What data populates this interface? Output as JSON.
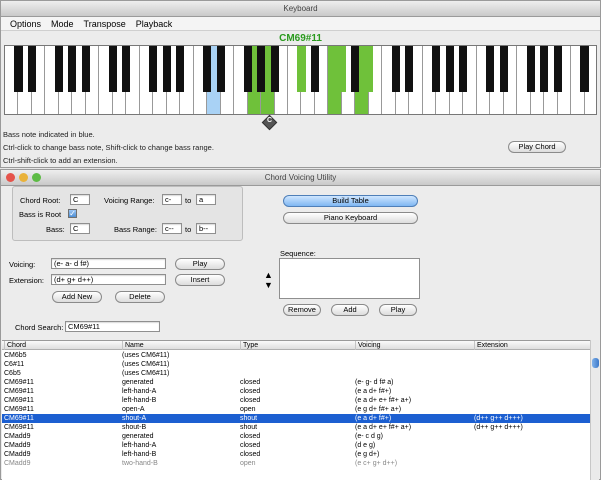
{
  "keyboard_window": {
    "title": "Keyboard",
    "menu": [
      "Options",
      "Mode",
      "Transpose",
      "Playback"
    ],
    "chord_name": "CM69#11",
    "bass_marker": "C",
    "hints": [
      "Bass note indicated in blue.",
      "Ctrl-click to change bass note, Shift-click to change bass range.",
      "Ctrl-shift-click to add an extension."
    ],
    "play_chord_label": "Play Chord",
    "colors": {
      "bass": "#a9d2f5",
      "active": "#6fc13a"
    }
  },
  "voicing_window": {
    "title": "Chord Voicing Utility",
    "chord_root_label": "Chord Root:",
    "chord_root_value": "C",
    "bass_is_root_label": "Bass is Root",
    "bass_label": "Bass:",
    "bass_value": "C",
    "voicing_range_label": "Voicing Range:",
    "voicing_range_from": "c-",
    "to_label": "to",
    "voicing_range_to": "a",
    "bass_range_label": "Bass Range:",
    "bass_range_from": "c--",
    "bass_range_to": "b--",
    "build_table_label": "Build Table",
    "piano_keyboard_label": "Piano Keyboard",
    "voicing_label": "Voicing:",
    "voicing_value": "(e- a- d f#)",
    "extension_label": "Extension:",
    "extension_value": "(d+ g+ d++)",
    "play_label": "Play",
    "insert_label": "Insert",
    "add_new_label": "Add New",
    "delete_label": "Delete",
    "sequence_label": "Sequence:",
    "up_arrow": "▲",
    "down_arrow": "▼",
    "remove_label": "Remove",
    "add_label": "Add",
    "seq_play_label": "Play",
    "chord_search_label": "Chord Search:",
    "chord_search_value": "CM69#11"
  },
  "table": {
    "columns": [
      "Chord",
      "Name",
      "Type",
      "Voicing",
      "Extension"
    ],
    "rows": [
      [
        "CM6b5",
        "(uses CM6#11)",
        "",
        "",
        ""
      ],
      [
        "C6#11",
        "(uses CM6#11)",
        "",
        "",
        ""
      ],
      [
        "C6b5",
        "(uses CM6#11)",
        "",
        "",
        ""
      ],
      [
        "CM69#11",
        "generated",
        "closed",
        "(e- g- d f# a)",
        ""
      ],
      [
        "CM69#11",
        "left-hand-A",
        "closed",
        "(e a d+ f#+)",
        ""
      ],
      [
        "CM69#11",
        "left-hand-B",
        "closed",
        "(e a d+ e+ f#+ a+)",
        ""
      ],
      [
        "CM69#11",
        "open-A",
        "open",
        "(e g d+ f#+ a+)",
        ""
      ],
      [
        "CM69#11",
        "shout-A",
        "shout",
        "(e a d+ f#+)",
        "(d++ g++ d+++)"
      ],
      [
        "CM69#11",
        "shout-B",
        "shout",
        "(e a d+ e+ f#+ a+)",
        "(d++ g++ d+++)"
      ],
      [
        "CMadd9",
        "generated",
        "closed",
        "(e- c d g)",
        ""
      ],
      [
        "CMadd9",
        "left-hand-A",
        "closed",
        "(d e g)",
        ""
      ],
      [
        "CMadd9",
        "left-hand-B",
        "closed",
        "(e g d+)",
        ""
      ],
      [
        "CMadd9",
        "two-hand-B",
        "open",
        "(e c+ g+ d++)",
        ""
      ]
    ],
    "selected_index": 7
  }
}
